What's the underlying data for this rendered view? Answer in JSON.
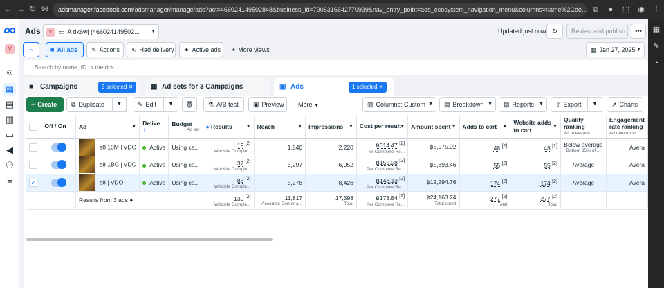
{
  "browser": {
    "zoom": "96",
    "url_domain": "adsmanager.facebook.com",
    "url_path": "/adsmanager/manage/ads?act=466024149502848&business_id=7906316642770939&nav_entry_point=ads_ecosystem_navigation_menu&columns=name%2Cde..."
  },
  "header": {
    "title": "Ads",
    "account_avatar": "V",
    "account_name": "A dk6wj (466024149502...",
    "updated": "Updated just now",
    "review_publish": "Review and publish"
  },
  "filters": {
    "all_ads": "All ads",
    "actions": "Actions",
    "had_delivery": "Had delivery",
    "active_ads": "Active ads",
    "more_views": "More views",
    "date": "Jan 27, 2025",
    "search_placeholder": "Search by name, ID or metrics"
  },
  "tabs": {
    "campaigns": "Campaigns",
    "campaigns_chip": "3 selected",
    "adsets": "Ad sets for 3 Campaigns",
    "ads": "Ads",
    "ads_chip": "1 selected"
  },
  "toolbar": {
    "create": "Create",
    "duplicate": "Duplicate",
    "edit": "Edit",
    "ab_test": "A/B test",
    "preview": "Preview",
    "more": "More",
    "columns": "Columns: Custom",
    "breakdown": "Breakdown",
    "reports": "Reports",
    "export": "Export",
    "charts": "Charts"
  },
  "columns": {
    "offon": "Off / On",
    "ad": "Ad",
    "delivery": "Delive",
    "budget": "Budget",
    "budget_sub": "Ad set",
    "results": "Results",
    "reach": "Reach",
    "impressions": "Impressions",
    "cpr": "Cost per result",
    "amount": "Amount spent",
    "atc": "Adds to cart",
    "wac": "Website adds to cart",
    "quality": "Quality ranking",
    "quality_sub": "Ad relevance...",
    "engagement": "Engagement rate ranking",
    "engagement_sub": "Ad relevance..."
  },
  "rows": [
    {
      "name": "s8 10M | VDO",
      "delivery": "Active",
      "budget": "Using ca...",
      "results": "19",
      "results_sub": "Website Comple...",
      "reach": "1,840",
      "impressions": "2,220",
      "cpr": "฿314.47",
      "cpr_sub": "Per Complete Re...",
      "amount": "฿5,975.02",
      "atc": "48",
      "wac": "48",
      "quality": "Below average",
      "quality_sub": "Bottom 35% of ...",
      "engagement": "Avera"
    },
    {
      "name": "s8 1BC | VDO",
      "delivery": "Active",
      "budget": "Using ca...",
      "results": "37",
      "results_sub": "Website Comple...",
      "reach": "5,297",
      "impressions": "6,952",
      "cpr": "฿159.28",
      "cpr_sub": "Per Complete Re...",
      "amount": "฿5,893.46",
      "atc": "55",
      "wac": "55",
      "quality": "Average",
      "quality_sub": "",
      "engagement": "Avera"
    },
    {
      "name": "s8 | VDO",
      "delivery": "Active",
      "budget": "Using ca...",
      "results": "83",
      "results_sub": "Website Comple...",
      "reach": "5,278",
      "impressions": "8,426",
      "cpr": "฿148.13",
      "cpr_sub": "Per Complete Re...",
      "amount": "฿12,294.76",
      "atc": "174",
      "wac": "174",
      "quality": "Average",
      "quality_sub": "",
      "engagement": "Avera"
    }
  ],
  "totals": {
    "label": "Results from 3 ads",
    "results": "139",
    "results_sub": "Website Comple...",
    "reach": "11,817",
    "reach_sub": "Accounts Center a...",
    "impressions": "17,598",
    "impressions_sub": "Total",
    "cpr": "฿173.84",
    "cpr_sub": "Per Complete Re...",
    "amount": "฿24,163.24",
    "amount_sub": "Total spent",
    "atc": "277",
    "atc_sub": "Total",
    "wac": "277",
    "wac_sub": "Total"
  },
  "footnote_marker": "[2]",
  "colors": {
    "accent": "#1877f2",
    "create": "#1e7d4c",
    "active": "#42b72a"
  }
}
